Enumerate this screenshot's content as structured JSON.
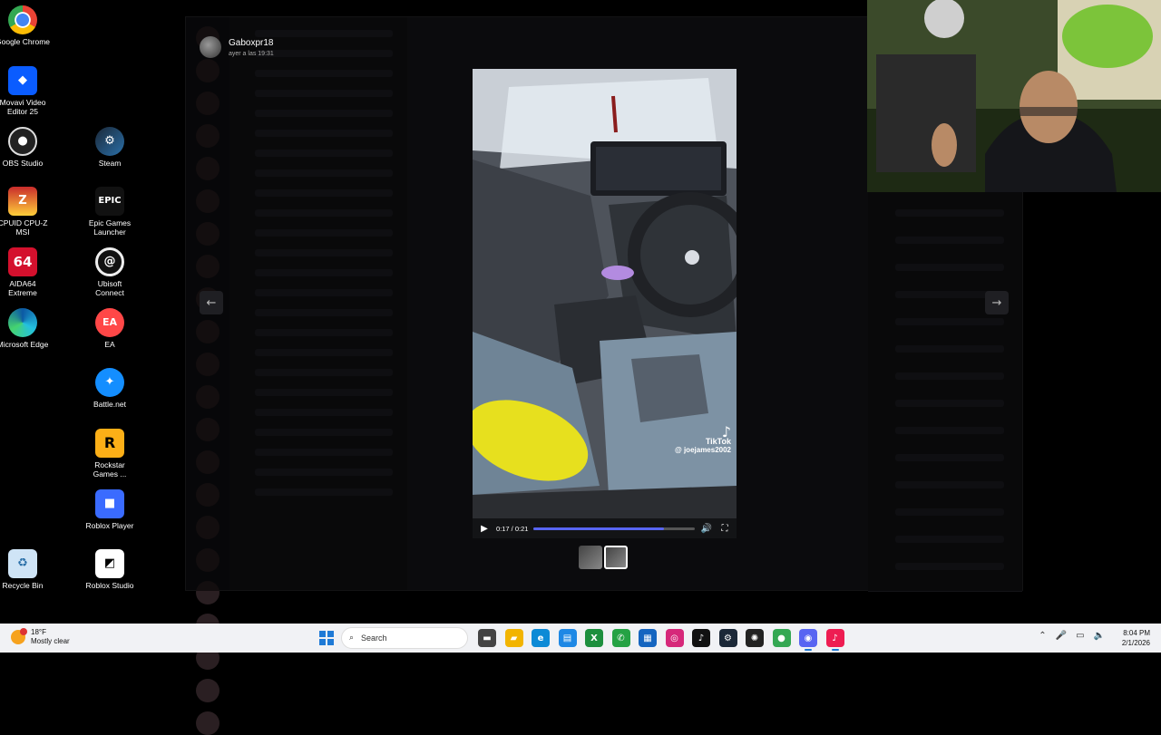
{
  "desktop_icons": [
    {
      "label": "Google Chrome",
      "icon": "chrome-icon",
      "glyph": ""
    },
    {
      "label": "Movavi Video Editor 25",
      "icon": "movavi-icon",
      "glyph": "◆"
    },
    {
      "label": "OBS Studio",
      "icon": "obs-icon",
      "glyph": "●"
    },
    {
      "label": "Steam",
      "icon": "steam-icon",
      "glyph": "⚙"
    },
    {
      "label": "CPUID CPU-Z MSI",
      "icon": "cpuz-icon",
      "glyph": "Z"
    },
    {
      "label": "Epic Games Launcher",
      "icon": "epic-games-icon",
      "glyph": "EPIC"
    },
    {
      "label": "AIDA64 Extreme",
      "icon": "aida64-icon",
      "glyph": "64"
    },
    {
      "label": "Ubisoft Connect",
      "icon": "ubisoft-icon",
      "glyph": "@"
    },
    {
      "label": "Microsoft Edge",
      "icon": "edge-icon",
      "glyph": ""
    },
    {
      "label": "EA",
      "icon": "ea-icon",
      "glyph": "EA"
    },
    {
      "label": "Battle.net",
      "icon": "battlenet-icon",
      "glyph": "✦"
    },
    {
      "label": "Rockstar Games ...",
      "icon": "rockstar-icon",
      "glyph": "R"
    },
    {
      "label": "Roblox Player",
      "icon": "roblox-icon",
      "glyph": "■"
    },
    {
      "label": "Recycle Bin",
      "icon": "recycle-bin-icon",
      "glyph": "♻"
    },
    {
      "label": "Roblox Studio",
      "icon": "roblox-studio-icon",
      "glyph": "◩"
    }
  ],
  "viewer": {
    "uploader_name": "Gaboxpr18",
    "uploader_time": "ayer a las 19:31",
    "prev_icon": "arrow-left-icon",
    "next_icon": "arrow-right-icon"
  },
  "video": {
    "watermark_brand": "TikTok",
    "watermark_handle": "@ joejames2002",
    "time_display": "0:17 / 0:21",
    "progress": 0.81
  },
  "taskbar": {
    "weather_temp": "18°F",
    "weather_desc": "Mostly clear",
    "search_placeholder": "Search",
    "clock_time": "8:04 PM",
    "clock_date": "2/1/2026",
    "apps": [
      {
        "name": "file-explorer-icon",
        "glyph": "▬",
        "color": "#444"
      },
      {
        "name": "folder-icon",
        "glyph": "▰",
        "color": "#f2b400"
      },
      {
        "name": "edge-icon",
        "glyph": "e",
        "color": "#0c8ad6"
      },
      {
        "name": "store-icon",
        "glyph": "▤",
        "color": "#1e88e5"
      },
      {
        "name": "xbox-icon",
        "glyph": "X",
        "color": "#1d8f3e"
      },
      {
        "name": "whatsapp-icon",
        "glyph": "✆",
        "color": "#25a244"
      },
      {
        "name": "calculator-icon",
        "glyph": "▦",
        "color": "#1565c0"
      },
      {
        "name": "instagram-icon",
        "glyph": "◎",
        "color": "#d6287a"
      },
      {
        "name": "tiktok-icon",
        "glyph": "♪",
        "color": "#111"
      },
      {
        "name": "steam-icon",
        "glyph": "⚙",
        "color": "#1b2838"
      },
      {
        "name": "chatgpt-icon",
        "glyph": "✺",
        "color": "#222"
      },
      {
        "name": "chrome-icon",
        "glyph": "●",
        "color": "#34a853"
      },
      {
        "name": "discord-icon",
        "glyph": "◉",
        "color": "#5865f2"
      },
      {
        "name": "tiktok-live-icon",
        "glyph": "♪",
        "color": "#ee1d52"
      }
    ]
  }
}
